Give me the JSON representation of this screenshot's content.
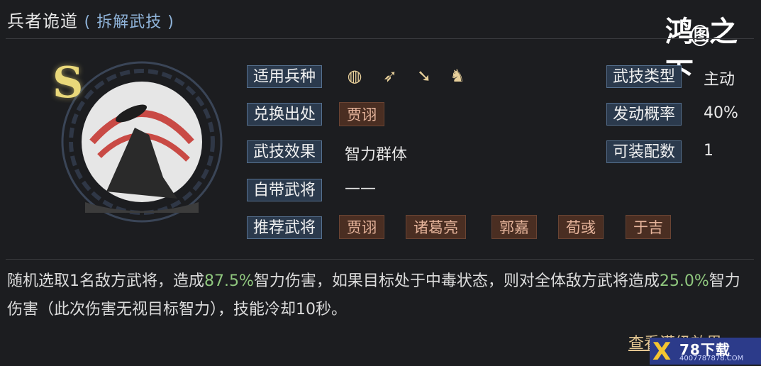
{
  "header": {
    "title": "兵者诡道",
    "subtitle": "( 拆解武技 )"
  },
  "logo": {
    "text_left": "鸿",
    "text_mid": "图",
    "text_right": "之下"
  },
  "skill": {
    "grade": "S"
  },
  "fields": {
    "unit_type_label": "适用兵种",
    "exchange_label": "兑换出处",
    "exchange_value": "贾诩",
    "effect_label": "武技效果",
    "effect_value": "智力群体",
    "own_general_label": "自带武将",
    "own_general_value": "——",
    "recommend_label": "推荐武将",
    "recommend_values": [
      "贾诩",
      "诸葛亮",
      "郭嘉",
      "荀彧",
      "于吉"
    ],
    "type_label": "武技类型",
    "type_value": "主动",
    "rate_label": "发动概率",
    "rate_value": "40%",
    "equip_label": "可装配数",
    "equip_value": "1"
  },
  "unit_icons": [
    "shield-icon",
    "bow-icon",
    "spear-icon",
    "horse-icon"
  ],
  "description": {
    "part1": "随机选取1名敌方武将，造成",
    "pct1": "87.5%",
    "part2": "智力伤害，如果目标处于中毒状态，则对全体敌方武将造成",
    "pct2": "25.0%",
    "part3": "智力伤害（此次伤害无视目标智力），技能冷却10秒。"
  },
  "more_link": "查看满级效果",
  "watermark": {
    "x": "X",
    "text": "78下载",
    "url": "4007787878.COM"
  }
}
